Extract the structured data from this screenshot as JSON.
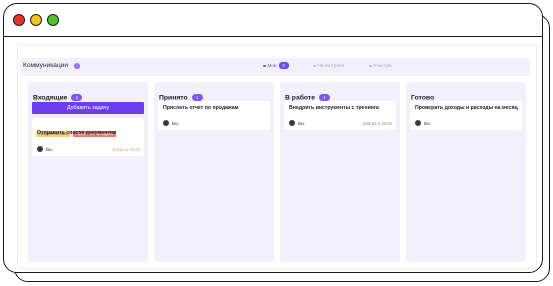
{
  "app": {
    "project_title": "Коммуникации",
    "info_icon": "i"
  },
  "filters": [
    {
      "label": "Мои",
      "count": "3",
      "active": true
    },
    {
      "label": "На контроле",
      "active": false
    },
    {
      "label": "Участую",
      "active": false
    }
  ],
  "columns": [
    {
      "title": "Входящие",
      "count": "1",
      "add_button": "Добавить задачу",
      "cards": [
        {
          "tags": [
            "Предметная зона",
            "Просроченная задача"
          ],
          "title": "Отправить список документов",
          "assignee": "Вы",
          "deadline": "Вчера в 20:00",
          "overdue": true
        }
      ]
    },
    {
      "title": "Принято",
      "count": "1",
      "cards": [
        {
          "title": "Прислать отчет по продажам",
          "assignee": "Вы",
          "deadline": ""
        }
      ]
    },
    {
      "title": "В работе",
      "count": "1",
      "cards": [
        {
          "title": "Внедрить инструменты с тренинга",
          "assignee": "Вы",
          "deadline": "Завтра в 20:00"
        }
      ]
    },
    {
      "title": "Готово",
      "count": "",
      "cards": [
        {
          "title": "Проверить доходы и расходы на месяц",
          "assignee": "Вы",
          "deadline": ""
        }
      ]
    }
  ],
  "colors": {
    "accent": "#6d3df0",
    "column_bg": "#f1f0fb",
    "overdue_tag": "#e27a6c",
    "subject_tag": "#f3d278"
  }
}
